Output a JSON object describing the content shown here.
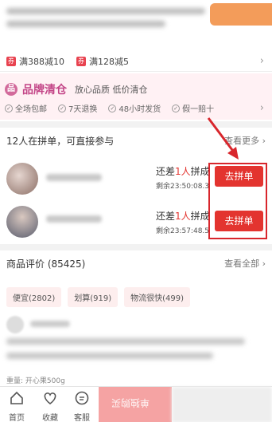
{
  "coupons": [
    "满388减10",
    "满128减5"
  ],
  "brand": {
    "title": "品牌清仓",
    "subtitle": "放心品质 低价清仓",
    "badge": "品",
    "features": [
      "全场包邮",
      "7天退换",
      "48小时发货",
      "假一赔十"
    ]
  },
  "group": {
    "header": "12人在拼单，可直接参与",
    "more": "查看更多",
    "items": [
      {
        "need_prefix": "还差",
        "need_num": "1人",
        "need_suffix": "拼成",
        "remain": "剩余23:50:08.3",
        "button": "去拼单"
      },
      {
        "need_prefix": "还差",
        "need_num": "1人",
        "need_suffix": "拼成",
        "remain": "剩余23:57:48.5",
        "button": "去拼单"
      }
    ]
  },
  "reviews": {
    "header": "商品评价 (85425)",
    "more": "查看全部",
    "tags": [
      "便宜(2802)",
      "划算(919)",
      "物流很快(499)"
    ],
    "weight": "重量: 开心果500g"
  },
  "bottom_nav": [
    "首页",
    "收藏",
    "客服"
  ],
  "buy_text": "单独购买",
  "colors": {
    "accent": "#e3342f",
    "brand": "#c34587",
    "brand_bg": "#fff1f4"
  }
}
